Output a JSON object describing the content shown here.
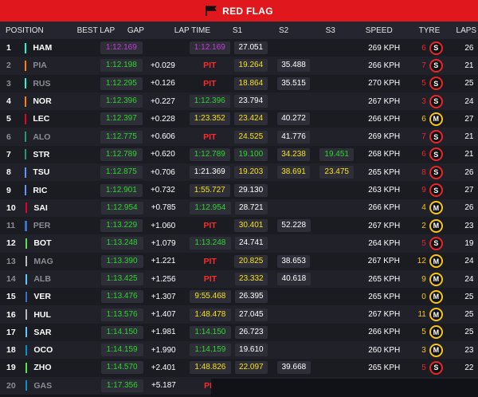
{
  "banner": {
    "label": "RED FLAG"
  },
  "headers": {
    "position": "POSITION",
    "best_lap": "BEST LAP",
    "gap": "GAP",
    "lap_time": "LAP TIME",
    "s1": "S1",
    "s2": "S2",
    "s3": "S3",
    "speed": "SPEED",
    "tyre": "TYRE",
    "laps": "LAPS"
  },
  "colors": {
    "purple": "#c23bd9",
    "green": "#2cd62c",
    "yellow": "#f5e11a",
    "red": "#ff2a2a",
    "white": "#ffffff",
    "grey": "#8a8a94",
    "soft": "#e8262d",
    "medium": "#f5c518"
  },
  "rows": [
    {
      "pos": "1",
      "driver": "HAM",
      "team": "#27f4d2",
      "dim": false,
      "best": "1:12.169",
      "best_c": "purple",
      "gap": "",
      "lt": "1:12.169",
      "lt_c": "purple",
      "s1": "27.051",
      "s1_c": "white",
      "s2": "",
      "s2_c": "white",
      "s3": "",
      "s3_c": "white",
      "speed": "269 KPH",
      "tn": "6",
      "tyre": "S",
      "laps": "26"
    },
    {
      "pos": "2",
      "driver": "PIA",
      "team": "#ff8000",
      "dim": true,
      "best": "1:12.198",
      "best_c": "green",
      "gap": "+0.029",
      "lt": "PIT",
      "lt_c": "red",
      "s1": "19.264",
      "s1_c": "yellow",
      "s2": "35.488",
      "s2_c": "white",
      "s3": "",
      "s3_c": "white",
      "speed": "266 KPH",
      "tn": "7",
      "tyre": "S",
      "laps": "21"
    },
    {
      "pos": "3",
      "driver": "RUS",
      "team": "#27f4d2",
      "dim": true,
      "best": "1:12.295",
      "best_c": "green",
      "gap": "+0.126",
      "lt": "PIT",
      "lt_c": "red",
      "s1": "18.864",
      "s1_c": "yellow",
      "s2": "35.515",
      "s2_c": "white",
      "s3": "",
      "s3_c": "white",
      "speed": "270 KPH",
      "tn": "5",
      "tyre": "S",
      "laps": "25"
    },
    {
      "pos": "4",
      "driver": "NOR",
      "team": "#ff8000",
      "dim": false,
      "best": "1:12.396",
      "best_c": "green",
      "gap": "+0.227",
      "lt": "1:12.396",
      "lt_c": "green",
      "s1": "23.794",
      "s1_c": "white",
      "s2": "",
      "s2_c": "white",
      "s3": "",
      "s3_c": "white",
      "speed": "267 KPH",
      "tn": "3",
      "tyre": "S",
      "laps": "24"
    },
    {
      "pos": "5",
      "driver": "LEC",
      "team": "#e8002d",
      "dim": false,
      "best": "1:12.397",
      "best_c": "green",
      "gap": "+0.228",
      "lt": "1:23.352",
      "lt_c": "yellow",
      "s1": "23.424",
      "s1_c": "yellow",
      "s2": "40.272",
      "s2_c": "white",
      "s3": "",
      "s3_c": "white",
      "speed": "266 KPH",
      "tn": "6",
      "tyre": "M",
      "laps": "27"
    },
    {
      "pos": "6",
      "driver": "ALO",
      "team": "#229971",
      "dim": true,
      "best": "1:12.775",
      "best_c": "green",
      "gap": "+0.606",
      "lt": "PIT",
      "lt_c": "red",
      "s1": "24.525",
      "s1_c": "yellow",
      "s2": "41.776",
      "s2_c": "white",
      "s3": "",
      "s3_c": "white",
      "speed": "269 KPH",
      "tn": "7",
      "tyre": "S",
      "laps": "21"
    },
    {
      "pos": "7",
      "driver": "STR",
      "team": "#229971",
      "dim": false,
      "best": "1:12.789",
      "best_c": "green",
      "gap": "+0.620",
      "lt": "1:12.789",
      "lt_c": "green",
      "s1": "19.100",
      "s1_c": "green",
      "s2": "34.238",
      "s2_c": "yellow",
      "s3": "19.451",
      "s3_c": "green",
      "speed": "268 KPH",
      "tn": "6",
      "tyre": "S",
      "laps": "21"
    },
    {
      "pos": "8",
      "driver": "TSU",
      "team": "#6692ff",
      "dim": false,
      "best": "1:12.875",
      "best_c": "green",
      "gap": "+0.706",
      "lt": "1:21.369",
      "lt_c": "white",
      "s1": "19.203",
      "s1_c": "yellow",
      "s2": "38.691",
      "s2_c": "yellow",
      "s3": "23.475",
      "s3_c": "yellow",
      "speed": "265 KPH",
      "tn": "8",
      "tyre": "S",
      "laps": "26"
    },
    {
      "pos": "9",
      "driver": "RIC",
      "team": "#6692ff",
      "dim": false,
      "best": "1:12.901",
      "best_c": "green",
      "gap": "+0.732",
      "lt": "1:55.727",
      "lt_c": "yellow",
      "s1": "29.130",
      "s1_c": "white",
      "s2": "",
      "s2_c": "white",
      "s3": "",
      "s3_c": "white",
      "speed": "263 KPH",
      "tn": "9",
      "tyre": "S",
      "laps": "27"
    },
    {
      "pos": "10",
      "driver": "SAI",
      "team": "#e8002d",
      "dim": false,
      "best": "1:12.954",
      "best_c": "green",
      "gap": "+0.785",
      "lt": "1:12.954",
      "lt_c": "green",
      "s1": "28.721",
      "s1_c": "white",
      "s2": "",
      "s2_c": "white",
      "s3": "",
      "s3_c": "white",
      "speed": "266 KPH",
      "tn": "4",
      "tyre": "M",
      "laps": "26"
    },
    {
      "pos": "11",
      "driver": "PER",
      "team": "#3671c6",
      "dim": true,
      "best": "1:13.229",
      "best_c": "green",
      "gap": "+1.060",
      "lt": "PIT",
      "lt_c": "red",
      "s1": "30.401",
      "s1_c": "yellow",
      "s2": "52.228",
      "s2_c": "white",
      "s3": "",
      "s3_c": "white",
      "speed": "267 KPH",
      "tn": "2",
      "tyre": "M",
      "laps": "23"
    },
    {
      "pos": "12",
      "driver": "BOT",
      "team": "#52e252",
      "dim": false,
      "best": "1:13.248",
      "best_c": "green",
      "gap": "+1.079",
      "lt": "1:13.248",
      "lt_c": "green",
      "s1": "24.741",
      "s1_c": "white",
      "s2": "",
      "s2_c": "white",
      "s3": "",
      "s3_c": "white",
      "speed": "264 KPH",
      "tn": "5",
      "tyre": "S",
      "laps": "19"
    },
    {
      "pos": "13",
      "driver": "MAG",
      "team": "#b6babd",
      "dim": true,
      "best": "1:13.390",
      "best_c": "green",
      "gap": "+1.221",
      "lt": "PIT",
      "lt_c": "red",
      "s1": "20.825",
      "s1_c": "yellow",
      "s2": "38.653",
      "s2_c": "white",
      "s3": "",
      "s3_c": "white",
      "speed": "267 KPH",
      "tn": "12",
      "tyre": "M",
      "laps": "24"
    },
    {
      "pos": "14",
      "driver": "ALB",
      "team": "#64c4ff",
      "dim": true,
      "best": "1:13.425",
      "best_c": "green",
      "gap": "+1.256",
      "lt": "PIT",
      "lt_c": "red",
      "s1": "23.332",
      "s1_c": "yellow",
      "s2": "40.618",
      "s2_c": "white",
      "s3": "",
      "s3_c": "white",
      "speed": "265 KPH",
      "tn": "9",
      "tyre": "M",
      "laps": "24"
    },
    {
      "pos": "15",
      "driver": "VER",
      "team": "#3671c6",
      "dim": false,
      "best": "1:13.476",
      "best_c": "green",
      "gap": "+1.307",
      "lt": "9:55.468",
      "lt_c": "yellow",
      "s1": "26.395",
      "s1_c": "white",
      "s2": "",
      "s2_c": "white",
      "s3": "",
      "s3_c": "white",
      "speed": "265 KPH",
      "tn": "0",
      "tyre": "M",
      "laps": "25"
    },
    {
      "pos": "16",
      "driver": "HUL",
      "team": "#b6babd",
      "dim": false,
      "best": "1:13.576",
      "best_c": "green",
      "gap": "+1.407",
      "lt": "1:48.478",
      "lt_c": "yellow",
      "s1": "27.045",
      "s1_c": "white",
      "s2": "",
      "s2_c": "white",
      "s3": "",
      "s3_c": "white",
      "speed": "267 KPH",
      "tn": "11",
      "tyre": "M",
      "laps": "25"
    },
    {
      "pos": "17",
      "driver": "SAR",
      "team": "#64c4ff",
      "dim": false,
      "best": "1:14.150",
      "best_c": "green",
      "gap": "+1.981",
      "lt": "1:14.150",
      "lt_c": "green",
      "s1": "26.723",
      "s1_c": "white",
      "s2": "",
      "s2_c": "white",
      "s3": "",
      "s3_c": "white",
      "speed": "266 KPH",
      "tn": "5",
      "tyre": "M",
      "laps": "25"
    },
    {
      "pos": "18",
      "driver": "OCO",
      "team": "#0093cc",
      "dim": false,
      "best": "1:14.159",
      "best_c": "green",
      "gap": "+1.990",
      "lt": "1:14.159",
      "lt_c": "green",
      "s1": "19.610",
      "s1_c": "white",
      "s2": "",
      "s2_c": "white",
      "s3": "",
      "s3_c": "white",
      "speed": "260 KPH",
      "tn": "3",
      "tyre": "M",
      "laps": "23"
    },
    {
      "pos": "19",
      "driver": "ZHO",
      "team": "#52e252",
      "dim": false,
      "best": "1:14.570",
      "best_c": "green",
      "gap": "+2.401",
      "lt": "1:48.826",
      "lt_c": "yellow",
      "s1": "22.097",
      "s1_c": "yellow",
      "s2": "39.668",
      "s2_c": "white",
      "s3": "",
      "s3_c": "white",
      "speed": "265 KPH",
      "tn": "5",
      "tyre": "S",
      "laps": "22"
    },
    {
      "pos": "20",
      "driver": "GAS",
      "team": "#0093cc",
      "dim": true,
      "best": "1:17.356",
      "best_c": "green",
      "gap": "+5.187",
      "lt": "PIT",
      "lt_c": "red",
      "s1": "",
      "s1_c": "white",
      "s2": "",
      "s2_c": "white",
      "s3": "",
      "s3_c": "white",
      "speed": "",
      "tn": "",
      "tyre": "",
      "laps": ""
    }
  ]
}
